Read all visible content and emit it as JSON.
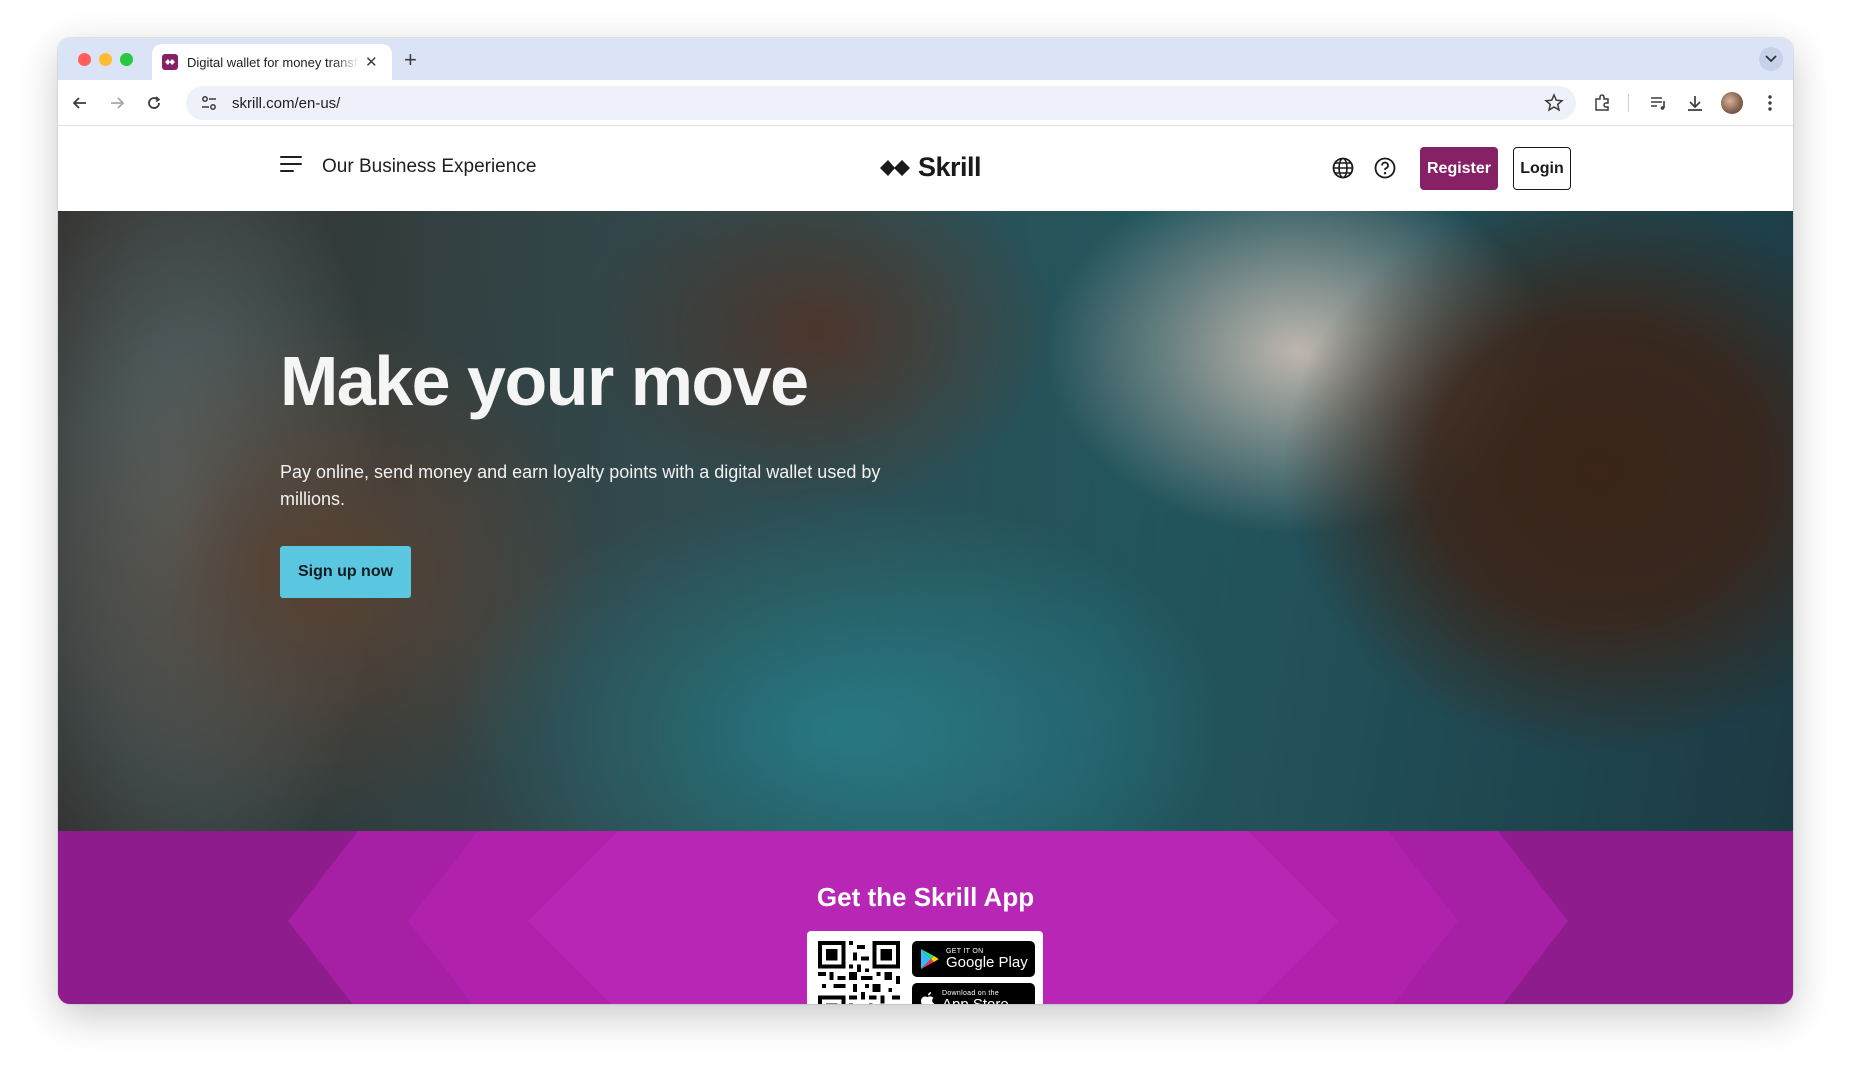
{
  "browser": {
    "tab_title": "Digital wallet for money transfers",
    "url": "skrill.com/en-us/"
  },
  "header": {
    "business_link": "Our Business Experience",
    "logo_text": "Skrill",
    "register_label": "Register",
    "login_label": "Login"
  },
  "hero": {
    "title": "Make your move",
    "subtitle": "Pay online, send money and earn loyalty points with a digital wallet used by millions.",
    "cta_label": "Sign up now"
  },
  "app_section": {
    "title": "Get the Skrill App",
    "google_play_small": "GET IT ON",
    "google_play_big": "Google Play",
    "app_store_small": "Download on the",
    "app_store_big": "App Store"
  },
  "colors": {
    "brand_purple": "#862165",
    "cta_cyan": "#5bc6e0",
    "band_purple": "#a71da4"
  }
}
